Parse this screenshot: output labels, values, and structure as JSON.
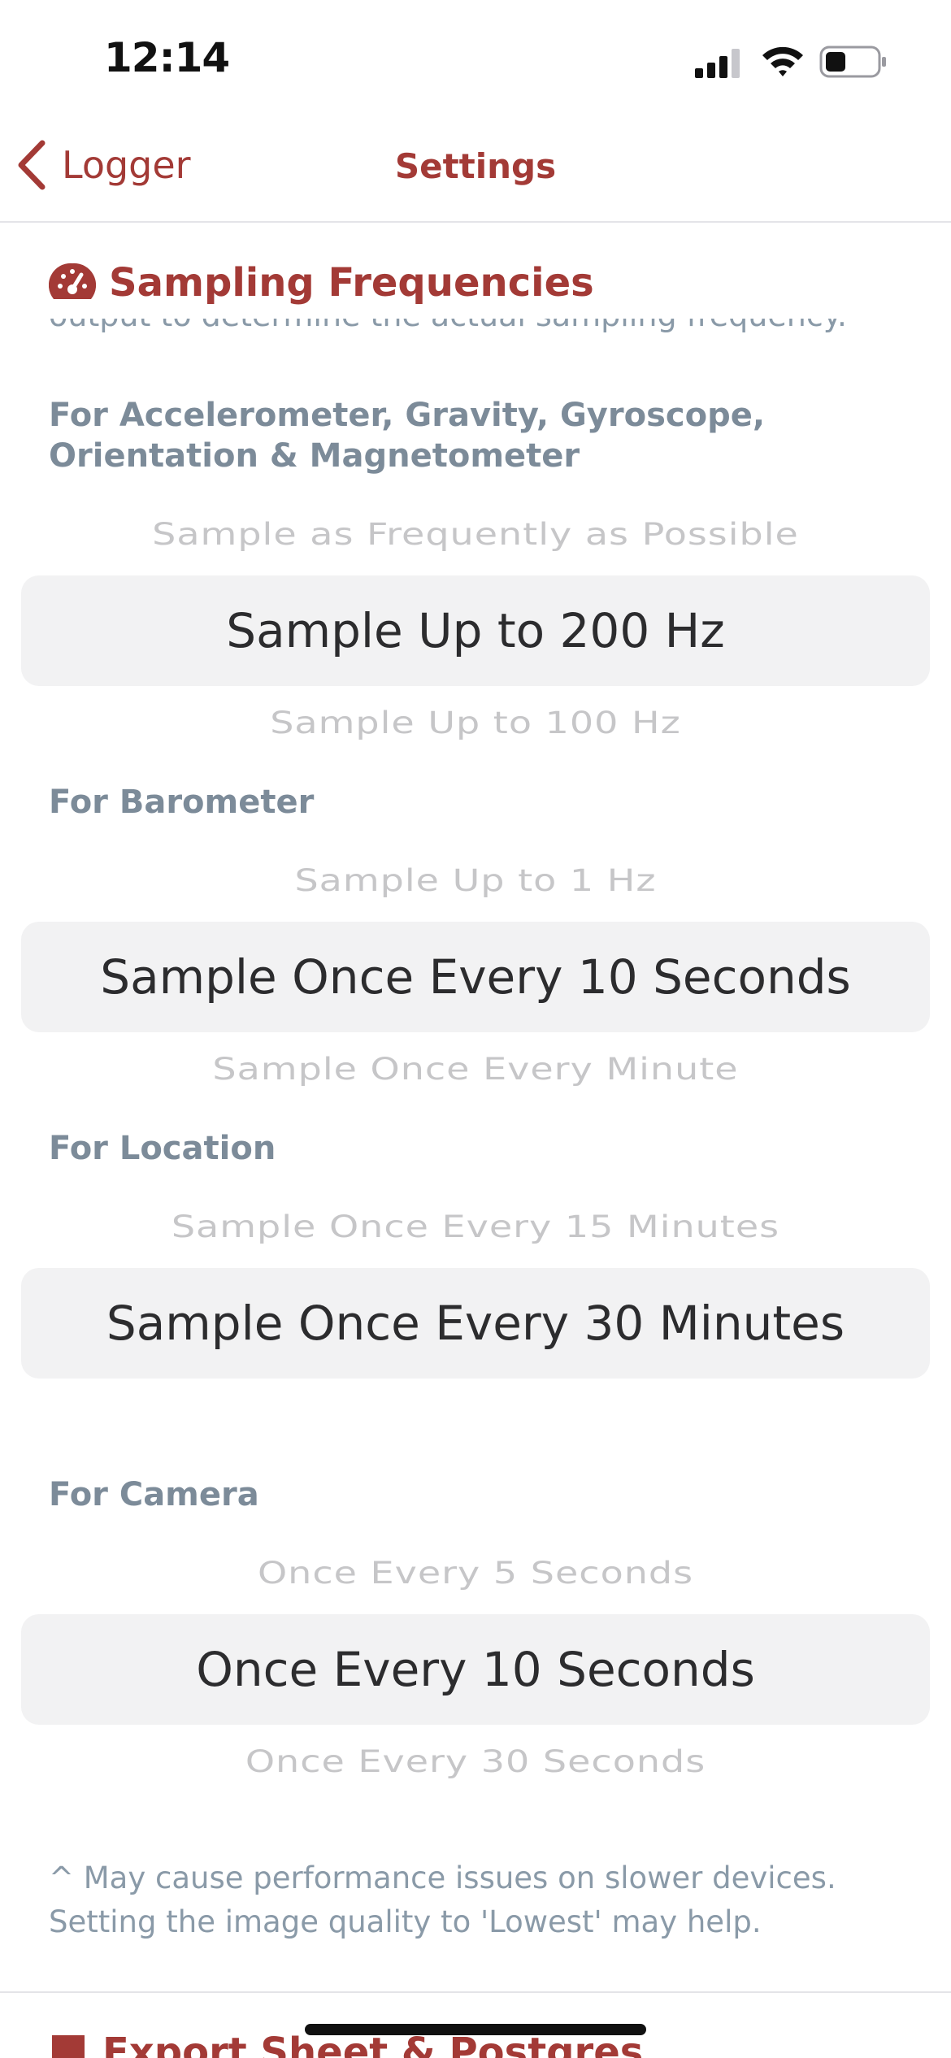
{
  "status_bar": {
    "time": "12:14"
  },
  "nav": {
    "back_label": "Logger",
    "title": "Settings"
  },
  "section": {
    "title": "Sampling Frequencies",
    "clipped_text": "output to determine the actual sampling frequency."
  },
  "groups": {
    "motion": {
      "label": "For Accelerometer, Gravity, Gyroscope, Orientation & Magnetometer",
      "above": "Sample as Frequently as Possible",
      "selected": "Sample Up to 200 Hz",
      "below": "Sample Up to 100 Hz"
    },
    "barometer": {
      "label": "For Barometer",
      "above": "Sample Up to 1 Hz",
      "selected": "Sample Once Every 10 Seconds",
      "below": "Sample Once Every Minute"
    },
    "location": {
      "label": "For Location",
      "above": "Sample Once Every 15 Minutes",
      "selected": "Sample Once Every 30 Minutes"
    },
    "camera": {
      "label": "For Camera",
      "above": "Once Every 5 Seconds",
      "selected": "Once Every 10 Seconds",
      "below": "Once Every 30 Seconds"
    }
  },
  "footnote": "^ May cause performance issues on slower devices. Setting the image quality to 'Lowest' may help.",
  "next_section": {
    "title": "Export Sheet & Postgres"
  },
  "colors": {
    "accent": "#a33a36",
    "label": "#7c8b99",
    "picker_bg": "#f2f2f3"
  }
}
